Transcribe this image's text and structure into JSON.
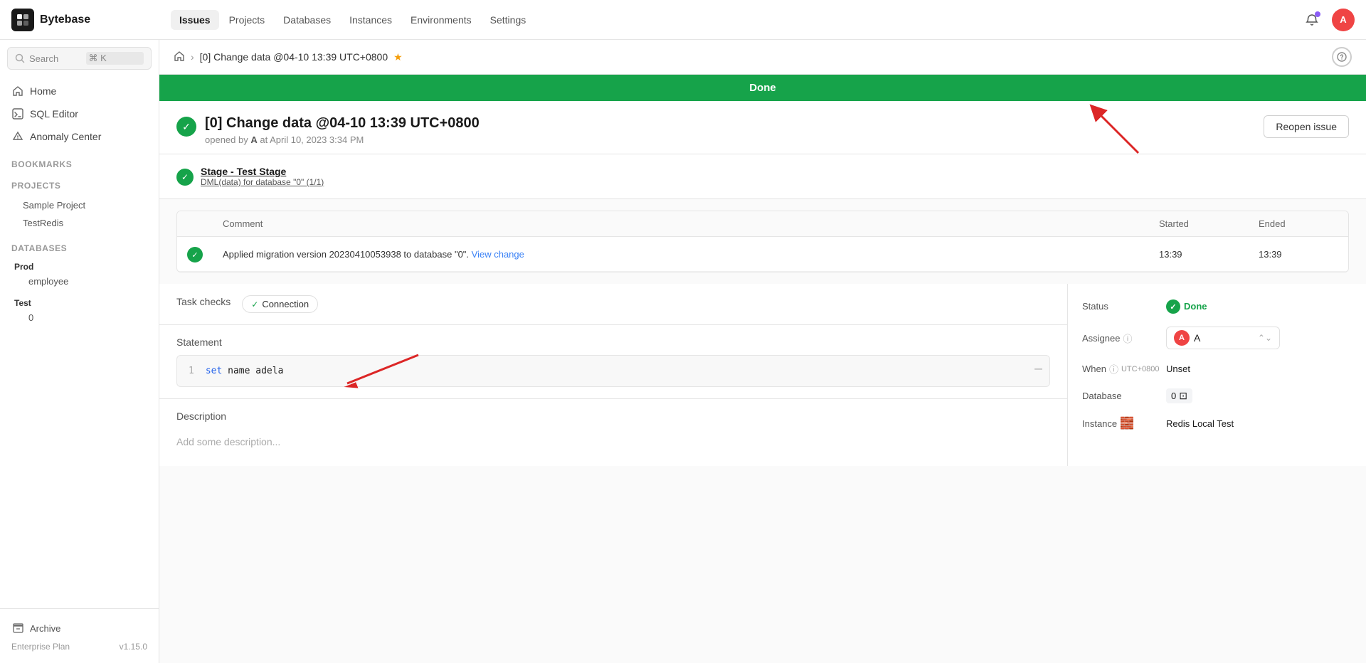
{
  "app": {
    "name": "Bytebase",
    "logo_text": "B"
  },
  "topnav": {
    "items": [
      {
        "label": "Issues",
        "active": true
      },
      {
        "label": "Projects",
        "active": false
      },
      {
        "label": "Databases",
        "active": false
      },
      {
        "label": "Instances",
        "active": false
      },
      {
        "label": "Environments",
        "active": false
      },
      {
        "label": "Settings",
        "active": false
      }
    ],
    "avatar_letter": "A"
  },
  "sidebar": {
    "search_placeholder": "Search",
    "search_shortcut": "⌘ K",
    "nav_items": [
      {
        "id": "home",
        "label": "Home",
        "icon": "🏠"
      },
      {
        "id": "sql-editor",
        "label": "SQL Editor",
        "icon": "🗄"
      },
      {
        "id": "anomaly-center",
        "label": "Anomaly Center",
        "icon": "🛡"
      }
    ],
    "bookmarks_label": "Bookmarks",
    "projects_label": "Projects",
    "projects": [
      {
        "label": "Sample Project"
      },
      {
        "label": "TestRedis"
      }
    ],
    "databases_label": "Databases",
    "databases": [
      {
        "group": "Prod",
        "items": [
          "employee"
        ]
      },
      {
        "group": "Test",
        "items": [
          "0"
        ]
      }
    ],
    "archive_label": "Archive",
    "plan_label": "Enterprise Plan",
    "version": "v1.15.0"
  },
  "breadcrumb": {
    "home_icon": "🏠",
    "current": "[0] Change data @04-10 13:39 UTC+0800"
  },
  "done_banner": "Done",
  "issue": {
    "title": "[0] Change data @04-10 13:39 UTC+0800",
    "opened_by": "A",
    "opened_at": "April 10, 2023 3:34 PM",
    "reopen_label": "Reopen issue",
    "stage_title": "Stage - Test Stage",
    "stage_subtitle": "DML(data) for database \"0\" (1/1)"
  },
  "migration_table": {
    "columns": [
      "",
      "Comment",
      "Started",
      "Ended"
    ],
    "rows": [
      {
        "comment_main": "Applied migration version 20230410053938 to database \"0\".",
        "comment_link": "View change",
        "started": "13:39",
        "ended": "13:39"
      }
    ]
  },
  "task_checks": {
    "label": "Task checks",
    "connection_label": "Connection"
  },
  "statement": {
    "title": "Statement",
    "line_number": "1",
    "code_keyword": "set",
    "code_rest": " name adela"
  },
  "description": {
    "title": "Description",
    "placeholder": "Add some description..."
  },
  "side_panel": {
    "status_label": "Status",
    "status_value": "Done",
    "assignee_label": "Assignee",
    "assignee_value": "A",
    "when_label": "When",
    "when_timezone": "UTC+0800",
    "when_value": "Unset",
    "database_label": "Database",
    "database_value": "0",
    "instance_label": "Instance",
    "instance_value": "Redis Local Test"
  }
}
